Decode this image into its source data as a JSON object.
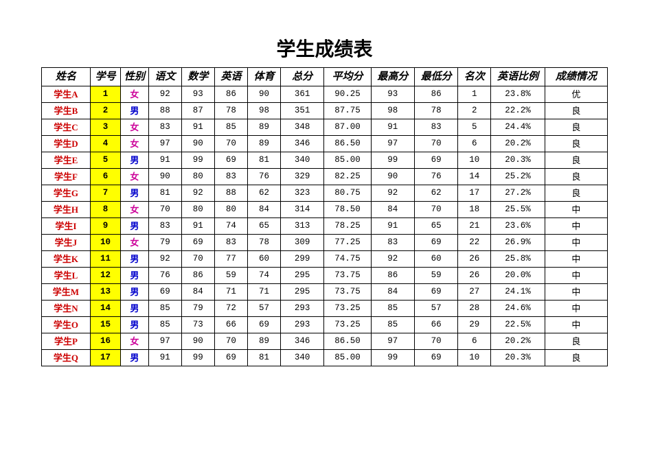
{
  "title": "学生成绩表",
  "columns": [
    "姓名",
    "学号",
    "性别",
    "语文",
    "数学",
    "英语",
    "体育",
    "总分",
    "平均分",
    "最高分",
    "最低分",
    "名次",
    "英语比例",
    "成绩情况"
  ],
  "rows": [
    {
      "name": "学生A",
      "id": "1",
      "gender": "女",
      "chinese": "92",
      "math": "93",
      "english": "86",
      "pe": "90",
      "total": "361",
      "avg": "90.25",
      "max": "93",
      "min": "86",
      "rank": "1",
      "enratio": "23.8%",
      "status": "优"
    },
    {
      "name": "学生B",
      "id": "2",
      "gender": "男",
      "chinese": "88",
      "math": "87",
      "english": "78",
      "pe": "98",
      "total": "351",
      "avg": "87.75",
      "max": "98",
      "min": "78",
      "rank": "2",
      "enratio": "22.2%",
      "status": "良"
    },
    {
      "name": "学生C",
      "id": "3",
      "gender": "女",
      "chinese": "83",
      "math": "91",
      "english": "85",
      "pe": "89",
      "total": "348",
      "avg": "87.00",
      "max": "91",
      "min": "83",
      "rank": "5",
      "enratio": "24.4%",
      "status": "良"
    },
    {
      "name": "学生D",
      "id": "4",
      "gender": "女",
      "chinese": "97",
      "math": "90",
      "english": "70",
      "pe": "89",
      "total": "346",
      "avg": "86.50",
      "max": "97",
      "min": "70",
      "rank": "6",
      "enratio": "20.2%",
      "status": "良"
    },
    {
      "name": "学生E",
      "id": "5",
      "gender": "男",
      "chinese": "91",
      "math": "99",
      "english": "69",
      "pe": "81",
      "total": "340",
      "avg": "85.00",
      "max": "99",
      "min": "69",
      "rank": "10",
      "enratio": "20.3%",
      "status": "良"
    },
    {
      "name": "学生F",
      "id": "6",
      "gender": "女",
      "chinese": "90",
      "math": "80",
      "english": "83",
      "pe": "76",
      "total": "329",
      "avg": "82.25",
      "max": "90",
      "min": "76",
      "rank": "14",
      "enratio": "25.2%",
      "status": "良"
    },
    {
      "name": "学生G",
      "id": "7",
      "gender": "男",
      "chinese": "81",
      "math": "92",
      "english": "88",
      "pe": "62",
      "total": "323",
      "avg": "80.75",
      "max": "92",
      "min": "62",
      "rank": "17",
      "enratio": "27.2%",
      "status": "良"
    },
    {
      "name": "学生H",
      "id": "8",
      "gender": "女",
      "chinese": "70",
      "math": "80",
      "english": "80",
      "pe": "84",
      "total": "314",
      "avg": "78.50",
      "max": "84",
      "min": "70",
      "rank": "18",
      "enratio": "25.5%",
      "status": "中"
    },
    {
      "name": "学生I",
      "id": "9",
      "gender": "男",
      "chinese": "83",
      "math": "91",
      "english": "74",
      "pe": "65",
      "total": "313",
      "avg": "78.25",
      "max": "91",
      "min": "65",
      "rank": "21",
      "enratio": "23.6%",
      "status": "中"
    },
    {
      "name": "学生J",
      "id": "10",
      "gender": "女",
      "chinese": "79",
      "math": "69",
      "english": "83",
      "pe": "78",
      "total": "309",
      "avg": "77.25",
      "max": "83",
      "min": "69",
      "rank": "22",
      "enratio": "26.9%",
      "status": "中"
    },
    {
      "name": "学生K",
      "id": "11",
      "gender": "男",
      "chinese": "92",
      "math": "70",
      "english": "77",
      "pe": "60",
      "total": "299",
      "avg": "74.75",
      "max": "92",
      "min": "60",
      "rank": "26",
      "enratio": "25.8%",
      "status": "中"
    },
    {
      "name": "学生L",
      "id": "12",
      "gender": "男",
      "chinese": "76",
      "math": "86",
      "english": "59",
      "pe": "74",
      "total": "295",
      "avg": "73.75",
      "max": "86",
      "min": "59",
      "rank": "26",
      "enratio": "20.0%",
      "status": "中"
    },
    {
      "name": "学生M",
      "id": "13",
      "gender": "男",
      "chinese": "69",
      "math": "84",
      "english": "71",
      "pe": "71",
      "total": "295",
      "avg": "73.75",
      "max": "84",
      "min": "69",
      "rank": "27",
      "enratio": "24.1%",
      "status": "中"
    },
    {
      "name": "学生N",
      "id": "14",
      "gender": "男",
      "chinese": "85",
      "math": "79",
      "english": "72",
      "pe": "57",
      "total": "293",
      "avg": "73.25",
      "max": "85",
      "min": "57",
      "rank": "28",
      "enratio": "24.6%",
      "status": "中"
    },
    {
      "name": "学生O",
      "id": "15",
      "gender": "男",
      "chinese": "85",
      "math": "73",
      "english": "66",
      "pe": "69",
      "total": "293",
      "avg": "73.25",
      "max": "85",
      "min": "66",
      "rank": "29",
      "enratio": "22.5%",
      "status": "中"
    },
    {
      "name": "学生P",
      "id": "16",
      "gender": "女",
      "chinese": "97",
      "math": "90",
      "english": "70",
      "pe": "89",
      "total": "346",
      "avg": "86.50",
      "max": "97",
      "min": "70",
      "rank": "6",
      "enratio": "20.2%",
      "status": "良"
    },
    {
      "name": "学生Q",
      "id": "17",
      "gender": "男",
      "chinese": "91",
      "math": "99",
      "english": "69",
      "pe": "81",
      "total": "340",
      "avg": "85.00",
      "max": "99",
      "min": "69",
      "rank": "10",
      "enratio": "20.3%",
      "status": "良"
    }
  ],
  "chart_data": {
    "type": "table",
    "title": "学生成绩表",
    "columns": [
      "姓名",
      "学号",
      "性别",
      "语文",
      "数学",
      "英语",
      "体育",
      "总分",
      "平均分",
      "最高分",
      "最低分",
      "名次",
      "英语比例",
      "成绩情况"
    ],
    "rows": [
      [
        "学生A",
        1,
        "女",
        92,
        93,
        86,
        90,
        361,
        90.25,
        93,
        86,
        1,
        "23.8%",
        "优"
      ],
      [
        "学生B",
        2,
        "男",
        88,
        87,
        78,
        98,
        351,
        87.75,
        98,
        78,
        2,
        "22.2%",
        "良"
      ],
      [
        "学生C",
        3,
        "女",
        83,
        91,
        85,
        89,
        348,
        87.0,
        91,
        83,
        5,
        "24.4%",
        "良"
      ],
      [
        "学生D",
        4,
        "女",
        97,
        90,
        70,
        89,
        346,
        86.5,
        97,
        70,
        6,
        "20.2%",
        "良"
      ],
      [
        "学生E",
        5,
        "男",
        91,
        99,
        69,
        81,
        340,
        85.0,
        99,
        69,
        10,
        "20.3%",
        "良"
      ],
      [
        "学生F",
        6,
        "女",
        90,
        80,
        83,
        76,
        329,
        82.25,
        90,
        76,
        14,
        "25.2%",
        "良"
      ],
      [
        "学生G",
        7,
        "男",
        81,
        92,
        88,
        62,
        323,
        80.75,
        92,
        62,
        17,
        "27.2%",
        "良"
      ],
      [
        "学生H",
        8,
        "女",
        70,
        80,
        80,
        84,
        314,
        78.5,
        84,
        70,
        18,
        "25.5%",
        "中"
      ],
      [
        "学生I",
        9,
        "男",
        83,
        91,
        74,
        65,
        313,
        78.25,
        91,
        65,
        21,
        "23.6%",
        "中"
      ],
      [
        "学生J",
        10,
        "女",
        79,
        69,
        83,
        78,
        309,
        77.25,
        83,
        69,
        22,
        "26.9%",
        "中"
      ],
      [
        "学生K",
        11,
        "男",
        92,
        70,
        77,
        60,
        299,
        74.75,
        92,
        60,
        26,
        "25.8%",
        "中"
      ],
      [
        "学生L",
        12,
        "男",
        76,
        86,
        59,
        74,
        295,
        73.75,
        86,
        59,
        26,
        "20.0%",
        "中"
      ],
      [
        "学生M",
        13,
        "男",
        69,
        84,
        71,
        71,
        295,
        73.75,
        84,
        69,
        27,
        "24.1%",
        "中"
      ],
      [
        "学生N",
        14,
        "男",
        85,
        79,
        72,
        57,
        293,
        73.25,
        85,
        57,
        28,
        "24.6%",
        "中"
      ],
      [
        "学生O",
        15,
        "男",
        85,
        73,
        66,
        69,
        293,
        73.25,
        85,
        66,
        29,
        "22.5%",
        "中"
      ],
      [
        "学生P",
        16,
        "女",
        97,
        90,
        70,
        89,
        346,
        86.5,
        97,
        70,
        6,
        "20.2%",
        "良"
      ],
      [
        "学生Q",
        17,
        "男",
        91,
        99,
        69,
        81,
        340,
        85.0,
        99,
        69,
        10,
        "20.3%",
        "良"
      ]
    ]
  }
}
